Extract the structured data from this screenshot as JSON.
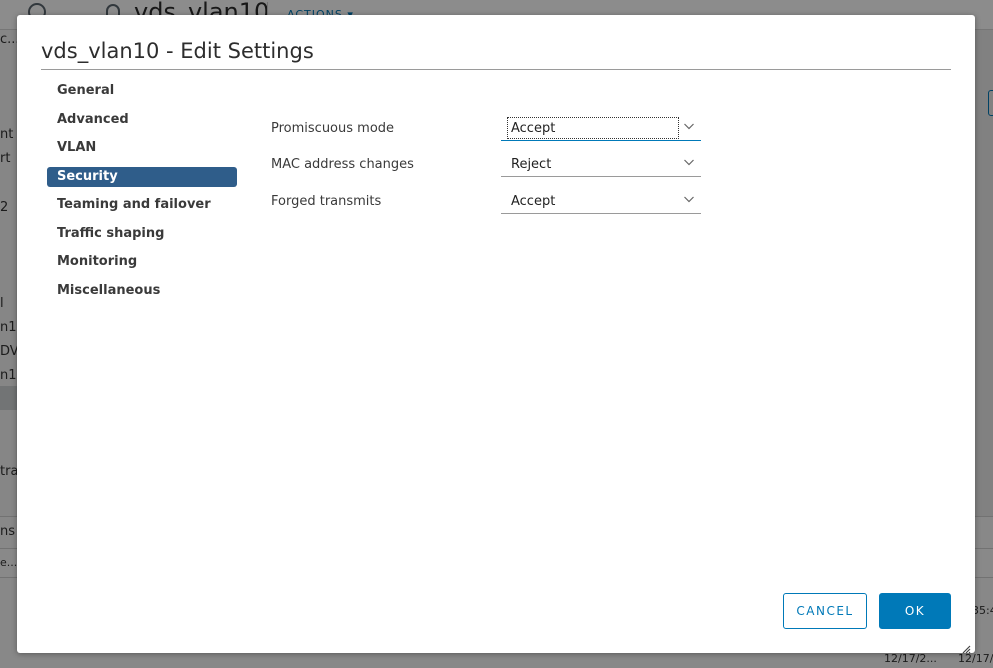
{
  "background": {
    "title": "vds_vlan10",
    "actions_label": "ACTIONS ▾",
    "left_fragments": [
      "c...",
      "nt",
      "rt",
      "2",
      "l",
      "n10",
      "DV",
      "n10",
      "tra"
    ],
    "bottom_fragments": [
      "ns",
      "e...",
      "12/17/2...",
      "12/17/2",
      "35:4"
    ]
  },
  "dialog": {
    "title": "vds_vlan10 - Edit Settings",
    "nav_items": [
      {
        "label": "General"
      },
      {
        "label": "Advanced"
      },
      {
        "label": "VLAN"
      },
      {
        "label": "Security",
        "active": true
      },
      {
        "label": "Teaming and failover"
      },
      {
        "label": "Traffic shaping"
      },
      {
        "label": "Monitoring"
      },
      {
        "label": "Miscellaneous"
      }
    ],
    "security": {
      "promiscuous_mode": {
        "label": "Promiscuous mode",
        "value": "Accept"
      },
      "mac_address_changes": {
        "label": "MAC address changes",
        "value": "Reject"
      },
      "forged_transmits": {
        "label": "Forged transmits",
        "value": "Accept"
      }
    },
    "buttons": {
      "cancel": "CANCEL",
      "ok": "OK"
    }
  },
  "colors": {
    "accent": "#0079b8",
    "nav_active": "#2f5d8a"
  },
  "icons": [
    "globe-icon",
    "lock-icon",
    "chevron-down-icon",
    "resize-handle-icon"
  ]
}
